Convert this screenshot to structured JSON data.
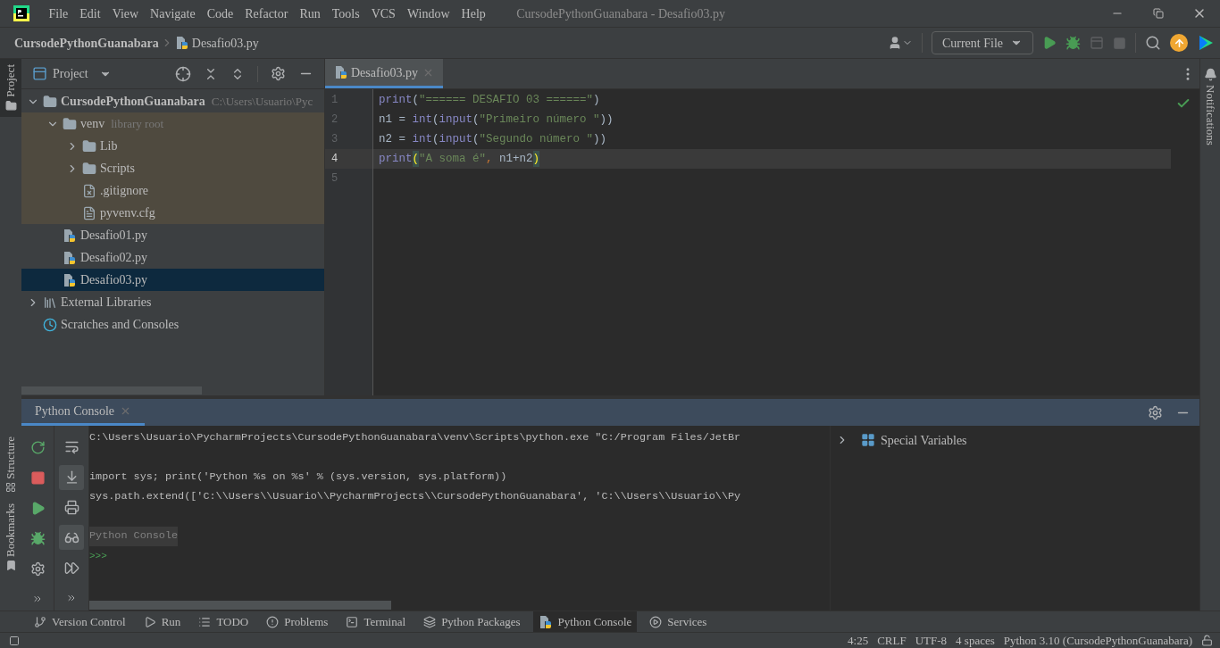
{
  "menu": [
    "File",
    "Edit",
    "View",
    "Navigate",
    "Code",
    "Refactor",
    "Run",
    "Tools",
    "VCS",
    "Window",
    "Help"
  ],
  "window_title": "CursodePythonGuanabara - Desafio03.py",
  "breadcrumb": [
    {
      "text": "CursodePythonGuanabara",
      "kind": "project"
    },
    {
      "text": "Desafio03.py",
      "kind": "python"
    }
  ],
  "run_config": "Current File",
  "left_stripe_top": [
    {
      "label": "Project",
      "selected": true
    }
  ],
  "left_stripe_bottom": [
    {
      "label": "Structure",
      "kind": "structure"
    },
    {
      "label": "Bookmarks",
      "kind": "bookmark"
    }
  ],
  "right_stripe": [
    {
      "label": "Notifications"
    }
  ],
  "project_panel": {
    "title": "Project",
    "tree": [
      {
        "name": "CursodePythonGuanabara",
        "hint": "C:\\Users\\Usuario\\Pyc",
        "kind": "project",
        "expanded": true,
        "selected": false,
        "children": [
          {
            "name": "venv",
            "hint": "library root",
            "kind": "library",
            "expanded": true,
            "selected": false,
            "children": [
              {
                "name": "Lib",
                "kind": "folder",
                "expanded": false,
                "selected": false
              },
              {
                "name": "Scripts",
                "kind": "folder",
                "expanded": false,
                "selected": false
              },
              {
                "name": ".gitignore",
                "kind": "ignored",
                "selected": false
              },
              {
                "name": "pyvenv.cfg",
                "kind": "config",
                "selected": false
              }
            ]
          },
          {
            "name": "Desafio01.py",
            "kind": "python",
            "selected": false
          },
          {
            "name": "Desafio02.py",
            "kind": "python",
            "selected": false
          },
          {
            "name": "Desafio03.py",
            "kind": "python",
            "selected": true
          }
        ]
      },
      {
        "name": "External Libraries",
        "kind": "libraries",
        "expanded": false,
        "selected": false
      },
      {
        "name": "Scratches and Consoles",
        "kind": "scratches",
        "selected": false
      }
    ]
  },
  "editor": {
    "tabs": [
      {
        "label": "Desafio03.py",
        "selected": true
      }
    ],
    "lines": [
      {
        "number": "1",
        "current": false,
        "tokens": [
          {
            "text": "print",
            "kind": "builtin"
          },
          {
            "text": "(",
            "kind": "plain"
          },
          {
            "text": "\"====== DESAFIO 03 ======\"",
            "kind": "string"
          },
          {
            "text": ")",
            "kind": "plain"
          }
        ]
      },
      {
        "number": "2",
        "current": false,
        "tokens": [
          {
            "text": "n1 = ",
            "kind": "plain"
          },
          {
            "text": "int",
            "kind": "builtin"
          },
          {
            "text": "(",
            "kind": "plain"
          },
          {
            "text": "input",
            "kind": "builtin"
          },
          {
            "text": "(",
            "kind": "plain"
          },
          {
            "text": "\"Primeiro número \"",
            "kind": "string"
          },
          {
            "text": "))",
            "kind": "plain"
          }
        ]
      },
      {
        "number": "3",
        "current": false,
        "tokens": [
          {
            "text": "n2 = ",
            "kind": "plain"
          },
          {
            "text": "int",
            "kind": "builtin"
          },
          {
            "text": "(",
            "kind": "plain"
          },
          {
            "text": "input",
            "kind": "builtin"
          },
          {
            "text": "(",
            "kind": "plain"
          },
          {
            "text": "\"Segundo número \"",
            "kind": "string"
          },
          {
            "text": "))",
            "kind": "plain"
          }
        ]
      },
      {
        "number": "4",
        "current": true,
        "tokens": [
          {
            "text": "print",
            "kind": "builtin"
          },
          {
            "text": "(",
            "kind": "brace"
          },
          {
            "text": "\"A soma é\"",
            "kind": "string"
          },
          {
            "text": ",",
            "kind": "punct"
          },
          {
            "text": " n1+n2",
            "kind": "plain"
          },
          {
            "text": ")",
            "kind": "brace"
          }
        ]
      },
      {
        "number": "5",
        "current": false
      }
    ]
  },
  "console": {
    "tab": {
      "label": "Python Console",
      "selected": true
    },
    "right_toolbar": [
      {
        "kind": "wrap",
        "on": false
      },
      {
        "kind": "scroll_end",
        "on": true
      },
      {
        "kind": "print",
        "on": false
      },
      {
        "kind": "glasses",
        "on": true
      },
      {
        "kind": "run_all",
        "on": false
      },
      {
        "kind": "more",
        "on": false
      }
    ],
    "lines": [
      {
        "kind": "output",
        "text": "C:\\Users\\Usuario\\PycharmProjects\\CursodePythonGuanabara\\venv\\Scripts\\python.exe \"C:/Program Files/JetBr"
      },
      {
        "kind": "gap"
      },
      {
        "kind": "output",
        "text": "import sys; print('Python %s on %s' % (sys.version, sys.platform))"
      },
      {
        "kind": "output",
        "text": "sys.path.extend(['C:\\\\Users\\\\Usuario\\\\PycharmProjects\\\\CursodePythonGuanabara', 'C:\\\\Users\\\\Usuario\\\\Py"
      },
      {
        "kind": "gap"
      },
      {
        "kind": "banner",
        "text": "Python Console"
      },
      {
        "kind": "prompt",
        "text": ">>>"
      }
    ],
    "variables": [
      {
        "label": "Special Variables",
        "expanded": false
      }
    ]
  },
  "tool_windows": [
    {
      "label": "Version Control",
      "kind": "branch",
      "selected": false
    },
    {
      "label": "Run",
      "kind": "run",
      "selected": false
    },
    {
      "label": "TODO",
      "kind": "list",
      "selected": false
    },
    {
      "label": "Problems",
      "kind": "problems",
      "selected": false
    },
    {
      "label": "Terminal",
      "kind": "terminal",
      "selected": false
    },
    {
      "label": "Python Packages",
      "kind": "layers",
      "selected": false
    },
    {
      "label": "Python Console",
      "kind": "python",
      "selected": true
    },
    {
      "label": "Services",
      "kind": "services",
      "selected": false
    }
  ],
  "status": [
    "4:25",
    "CRLF",
    "UTF-8",
    "4 spaces",
    "Python 3.10 (CursodePythonGuanabara)"
  ]
}
